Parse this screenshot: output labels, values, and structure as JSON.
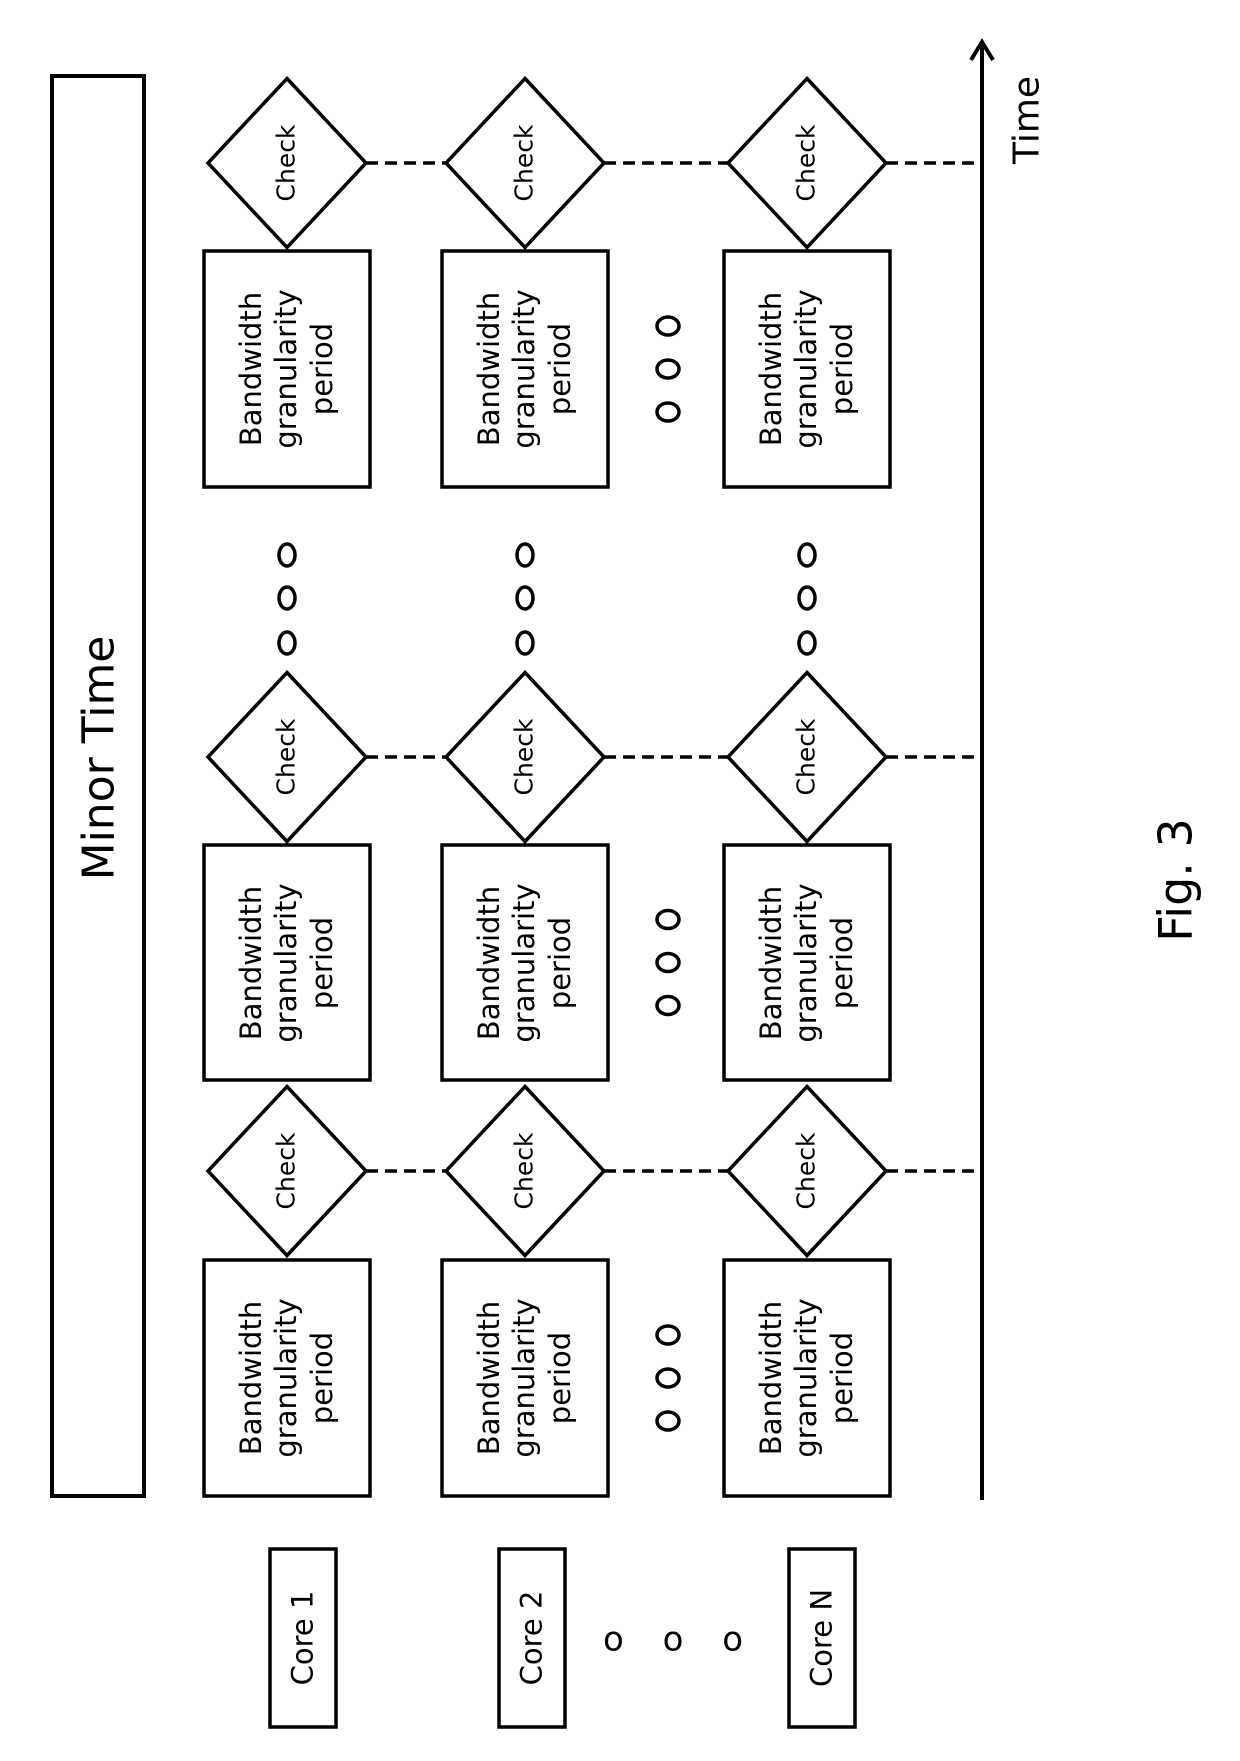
{
  "figure": {
    "label": "Fig. 3",
    "header_bar": "Minor Time",
    "axis_label": "Time",
    "ellipsis": "o o o"
  },
  "cores": [
    {
      "label": "Core 1"
    },
    {
      "label": "Core 2"
    },
    {
      "label": "Core N"
    }
  ],
  "timeline": {
    "periods_per_core": 3,
    "period_label_lines": [
      "Bandwidth",
      "granularity",
      "period"
    ],
    "check_label": "Check",
    "sequence": [
      "Bandwidth granularity period",
      "Check",
      "Bandwidth granularity period",
      "Check",
      "o o o",
      "Bandwidth granularity period",
      "Check"
    ]
  },
  "colors": {
    "stroke": "#000000",
    "background": "#ffffff"
  }
}
